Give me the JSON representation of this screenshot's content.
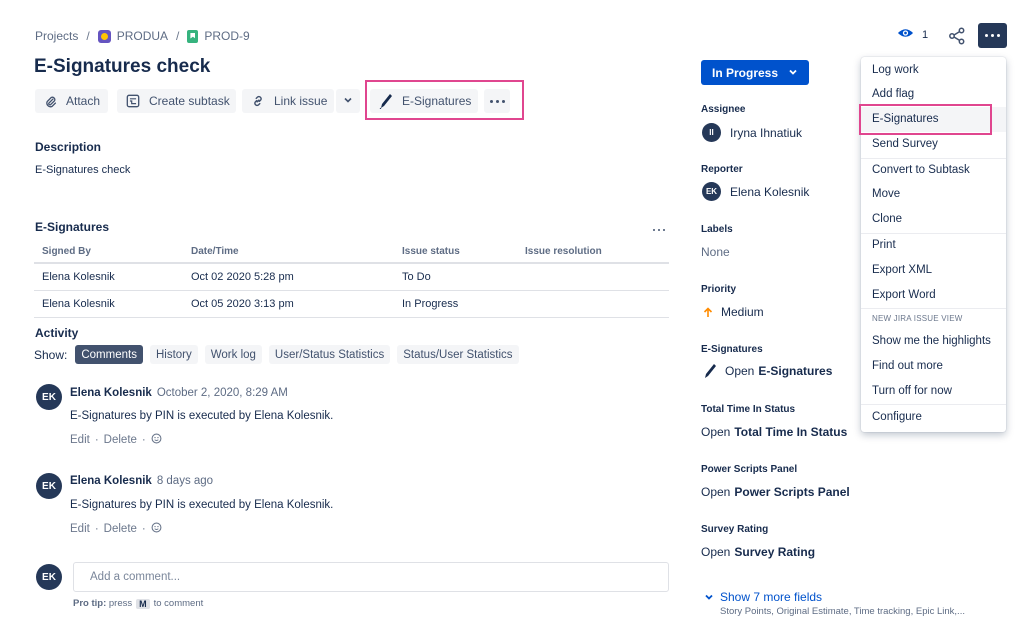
{
  "breadcrumb": {
    "projects": "Projects",
    "project": "PRODUA",
    "issue_key": "PROD-9"
  },
  "issue": {
    "title": "E-Signatures check"
  },
  "toolbar": {
    "attach": "Attach",
    "create_subtask": "Create subtask",
    "link_issue": "Link issue",
    "esignatures": "E-Signatures"
  },
  "description": {
    "heading": "Description",
    "text": "E-Signatures check"
  },
  "esignatures_panel": {
    "heading": "E-Signatures",
    "columns": [
      "Signed By",
      "Date/Time",
      "Issue status",
      "Issue resolution"
    ],
    "rows": [
      {
        "signed_by": "Elena Kolesnik",
        "datetime": "Oct 02 2020 5:28 pm",
        "status": "To Do",
        "resolution": ""
      },
      {
        "signed_by": "Elena Kolesnik",
        "datetime": "Oct 05 2020 3:13 pm",
        "status": "In Progress",
        "resolution": ""
      }
    ]
  },
  "activity": {
    "heading": "Activity",
    "show_label": "Show:",
    "tabs": [
      "Comments",
      "History",
      "Work log",
      "User/Status Statistics",
      "Status/User Statistics"
    ],
    "active_tab": "Comments"
  },
  "comments": [
    {
      "initials": "EK",
      "author": "Elena Kolesnik",
      "date": "October 2, 2020, 8:29 AM",
      "body": "E-Signatures by PIN is executed by Elena Kolesnik.",
      "edit": "Edit",
      "delete": "Delete"
    },
    {
      "initials": "EK",
      "author": "Elena Kolesnik",
      "date": "8 days ago",
      "body": "E-Signatures by PIN is executed by Elena Kolesnik.",
      "edit": "Edit",
      "delete": "Delete"
    }
  ],
  "new_comment": {
    "initials": "EK",
    "placeholder": "Add a comment...",
    "protip_label": "Pro tip:",
    "protip_press": "press",
    "protip_key": "M",
    "protip_rest": "to comment"
  },
  "header": {
    "watch_count": "1"
  },
  "sidebar": {
    "status": "In Progress",
    "assignee": {
      "label": "Assignee",
      "initials": "II",
      "name": "Iryna Ihnatiuk"
    },
    "reporter": {
      "label": "Reporter",
      "initials": "EK",
      "name": "Elena Kolesnik"
    },
    "labels": {
      "label": "Labels",
      "value": "None"
    },
    "priority": {
      "label": "Priority",
      "value": "Medium"
    },
    "esignatures": {
      "label": "E-Signatures",
      "open": "Open",
      "name": "E-Signatures"
    },
    "total_time": {
      "label": "Total Time In Status",
      "open": "Open",
      "name": "Total Time In Status"
    },
    "power_scripts": {
      "label": "Power Scripts Panel",
      "open": "Open",
      "name": "Power Scripts Panel"
    },
    "survey_rating": {
      "label": "Survey Rating",
      "open": "Open",
      "name": "Survey Rating"
    },
    "more_fields": "Show 7 more fields",
    "more_fields_sub": "Story Points, Original Estimate, Time tracking, Epic Link,..."
  },
  "menu": {
    "items": [
      "Log work",
      "Add flag",
      "E-Signatures",
      "Send Survey",
      "Convert to Subtask",
      "Move",
      "Clone",
      "Print",
      "Export XML",
      "Export Word"
    ],
    "section": "NEW JIRA ISSUE VIEW",
    "section_items": [
      "Show me the highlights",
      "Find out more",
      "Turn off for now"
    ],
    "configure": "Configure"
  },
  "colors": {
    "primary": "#0052cc",
    "highlight_border": "#e0468f",
    "priority_medium": "#ff8b00",
    "avatar_bg": "#253858"
  }
}
